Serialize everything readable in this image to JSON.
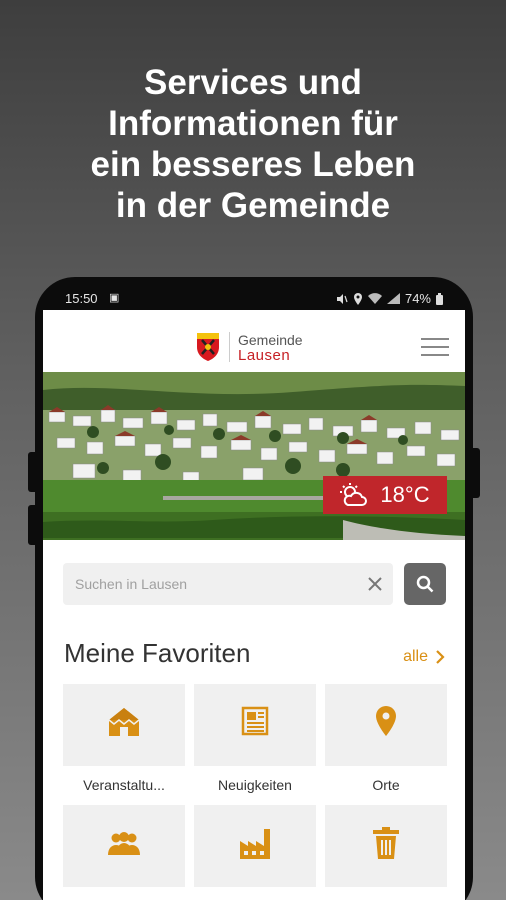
{
  "headline": {
    "line1": "Services und",
    "line2": "Informationen für",
    "line3": "ein besseres Leben",
    "line4": "in der Gemeinde"
  },
  "statusbar": {
    "time": "15:50",
    "battery": "74%"
  },
  "app": {
    "logo_top": "Gemeinde",
    "logo_bottom": "Lausen"
  },
  "weather": {
    "temperature": "18°C",
    "icon": "partly-cloudy-icon"
  },
  "search": {
    "placeholder": "Suchen in Lausen"
  },
  "favorites": {
    "title": "Meine Favoriten",
    "all_label": "alle",
    "items": [
      {
        "label": "Veranstaltu...",
        "icon": "house-tent-icon"
      },
      {
        "label": "Neuigkeiten",
        "icon": "newspaper-icon"
      },
      {
        "label": "Orte",
        "icon": "location-pin-icon"
      },
      {
        "label": "",
        "icon": "people-group-icon"
      },
      {
        "label": "",
        "icon": "factory-icon"
      },
      {
        "label": "",
        "icon": "trash-icon"
      }
    ]
  },
  "colors": {
    "accent": "#d99015",
    "brand_red": "#c0262b"
  }
}
